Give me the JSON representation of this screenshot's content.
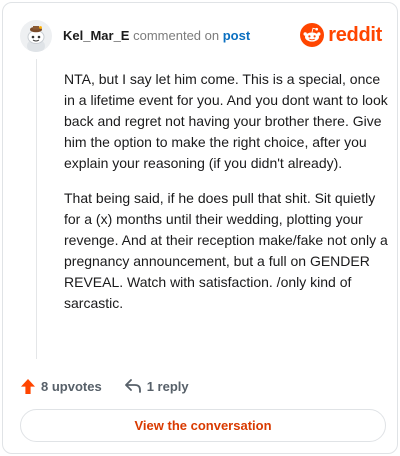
{
  "header": {
    "username": "Kel_Mar_E",
    "action_text": "commented on",
    "target_link": "post",
    "brand": "reddit"
  },
  "comment": {
    "paragraphs": [
      "NTA, but I say let him come. This is a special, once in a lifetime event for you. And you dont want to look back and regret not having your brother there. Give him the option to make the right choice, after you explain your reasoning (if you didn't already).",
      "That being said, if he does pull that shit. Sit quietly for a (x) months until their wedding, plotting your revenge. And at their reception make/fake not only a pregnancy announcement, but a full on GENDER REVEAL. Watch with satisfaction. /only kind of sarcastic."
    ]
  },
  "actions": {
    "upvotes": "8 upvotes",
    "replies": "1 reply"
  },
  "cta": {
    "label": "View the conversation"
  },
  "colors": {
    "brand_orange": "#ff4500",
    "link_blue": "#0a6fc0",
    "cta_text": "#d93a00",
    "muted_text": "#576069"
  },
  "icons": {
    "avatar": "snoo-avatar",
    "brand": "reddit-logo-icon",
    "upvote": "upvote-arrow-icon",
    "reply": "reply-arrow-icon"
  }
}
